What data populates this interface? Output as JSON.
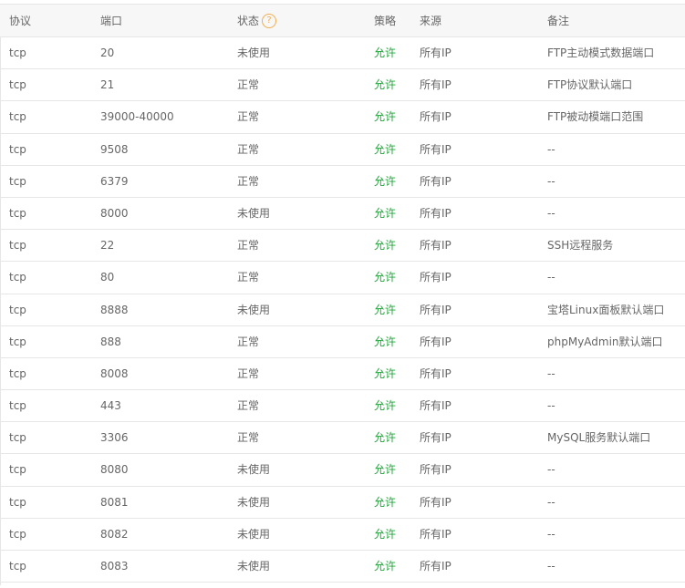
{
  "headers": {
    "protocol": "协议",
    "port": "端口",
    "status": "状态",
    "status_help_icon": "?",
    "policy": "策略",
    "source": "来源",
    "note": "备注"
  },
  "rows": [
    {
      "protocol": "tcp",
      "port": "20",
      "status": "未使用",
      "policy": "允许",
      "source": "所有IP",
      "note": "FTP主动模式数据端口"
    },
    {
      "protocol": "tcp",
      "port": "21",
      "status": "正常",
      "policy": "允许",
      "source": "所有IP",
      "note": "FTP协议默认端口"
    },
    {
      "protocol": "tcp",
      "port": "39000-40000",
      "status": "正常",
      "policy": "允许",
      "source": "所有IP",
      "note": "FTP被动模端口范围"
    },
    {
      "protocol": "tcp",
      "port": "9508",
      "status": "正常",
      "policy": "允许",
      "source": "所有IP",
      "note": "--"
    },
    {
      "protocol": "tcp",
      "port": "6379",
      "status": "正常",
      "policy": "允许",
      "source": "所有IP",
      "note": "--"
    },
    {
      "protocol": "tcp",
      "port": "8000",
      "status": "未使用",
      "policy": "允许",
      "source": "所有IP",
      "note": "--"
    },
    {
      "protocol": "tcp",
      "port": "22",
      "status": "正常",
      "policy": "允许",
      "source": "所有IP",
      "note": "SSH远程服务"
    },
    {
      "protocol": "tcp",
      "port": "80",
      "status": "正常",
      "policy": "允许",
      "source": "所有IP",
      "note": "--"
    },
    {
      "protocol": "tcp",
      "port": "8888",
      "status": "未使用",
      "policy": "允许",
      "source": "所有IP",
      "note": "宝塔Linux面板默认端口"
    },
    {
      "protocol": "tcp",
      "port": "888",
      "status": "正常",
      "policy": "允许",
      "source": "所有IP",
      "note": "phpMyAdmin默认端口"
    },
    {
      "protocol": "tcp",
      "port": "8008",
      "status": "正常",
      "policy": "允许",
      "source": "所有IP",
      "note": "--"
    },
    {
      "protocol": "tcp",
      "port": "443",
      "status": "正常",
      "policy": "允许",
      "source": "所有IP",
      "note": "--"
    },
    {
      "protocol": "tcp",
      "port": "3306",
      "status": "正常",
      "policy": "允许",
      "source": "所有IP",
      "note": "MySQL服务默认端口"
    },
    {
      "protocol": "tcp",
      "port": "8080",
      "status": "未使用",
      "policy": "允许",
      "source": "所有IP",
      "note": "--"
    },
    {
      "protocol": "tcp",
      "port": "8081",
      "status": "未使用",
      "policy": "允许",
      "source": "所有IP",
      "note": "--"
    },
    {
      "protocol": "tcp",
      "port": "8082",
      "status": "未使用",
      "policy": "允许",
      "source": "所有IP",
      "note": "--"
    },
    {
      "protocol": "tcp",
      "port": "8083",
      "status": "未使用",
      "policy": "允许",
      "source": "所有IP",
      "note": "--"
    }
  ],
  "colors": {
    "allow": "#20a53a",
    "help_icon": "#f0ad4e"
  }
}
